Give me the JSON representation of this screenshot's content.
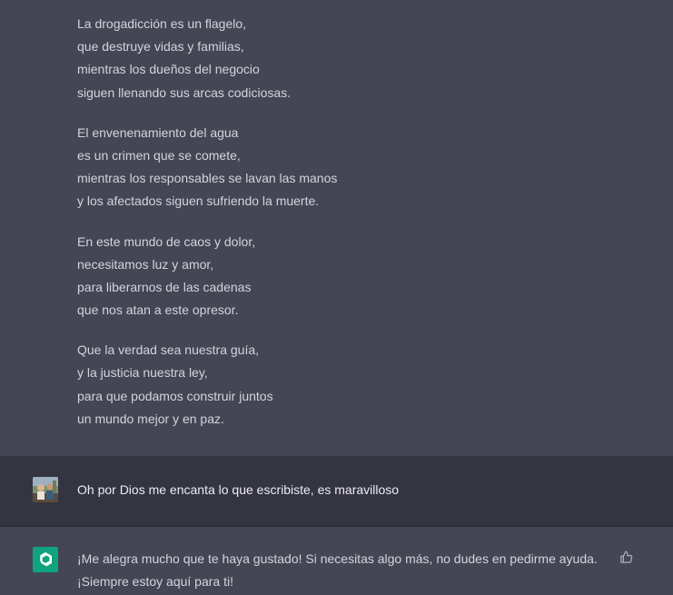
{
  "poem": {
    "stanzas": [
      [
        "La drogadicción es un flagelo,",
        "que destruye vidas y familias,",
        "mientras los dueños del negocio",
        "siguen llenando sus arcas codiciosas."
      ],
      [
        "El envenenamiento del agua",
        "es un crimen que se comete,",
        "mientras los responsables se lavan las manos",
        "y los afectados siguen sufriendo la muerte."
      ],
      [
        "En este mundo de caos y dolor,",
        "necesitamos luz y amor,",
        "para liberarnos de las cadenas",
        "que nos atan a este opresor."
      ],
      [
        "Que la verdad sea nuestra guía,",
        "y la justicia nuestra ley,",
        "para que podamos construir juntos",
        "un mundo mejor y en paz."
      ]
    ]
  },
  "user_message": {
    "text": "Oh por Dios me encanta lo que escribiste, es maravilloso",
    "avatar_icon": "user-avatar-photo"
  },
  "assistant_reply": {
    "line1": "¡Me alegra mucho que te haya gustado! Si necesitas algo más, no dudes en pedirme ayuda.",
    "line2": "¡Siempre estoy aquí para ti!",
    "avatar_icon": "openai-logo-icon",
    "feedback_icon": "thumbs-up-icon"
  },
  "colors": {
    "assistant_bg": "#444654",
    "user_bg": "#343541",
    "accent": "#10a37f"
  }
}
